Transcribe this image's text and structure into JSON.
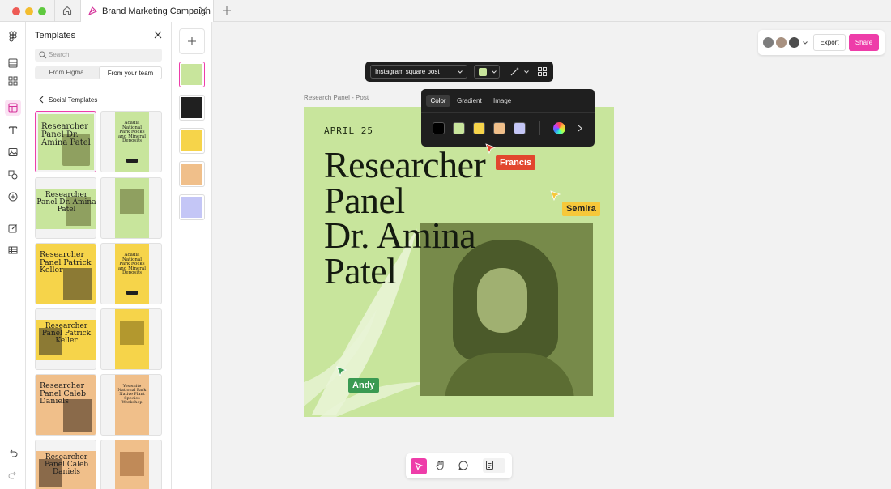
{
  "window": {
    "tab_title": "Brand Marketing Campaign"
  },
  "templates_panel": {
    "title": "Templates",
    "search_placeholder": "Search",
    "segments": [
      "From Figma",
      "From your team"
    ],
    "section_title": "Social Templates",
    "tiles": [
      {
        "text": "Researcher Panel Dr. Amina Patel",
        "bg": "#c8e59c",
        "selected": true
      },
      {
        "text": "Acadia National Park Rocks and Mineral Deposits",
        "bg": "#c8e59c"
      },
      {
        "text": "Researcher Panel Dr. Amina Patel",
        "bg": "#c8e59c"
      },
      {
        "text": "",
        "bg": "#c8e59c"
      },
      {
        "text": "Researcher Panel Patrick Keller",
        "bg": "#f6d44a"
      },
      {
        "text": "Acadia National Park Rocks and Mineral Deposits",
        "bg": "#f6d44a"
      },
      {
        "text": "Researcher Panel Patrick Keller",
        "bg": "#f6d44a"
      },
      {
        "text": "",
        "bg": "#f6d44a"
      },
      {
        "text": "Researcher Panel Caleb Daniels",
        "bg": "#f0bf8a"
      },
      {
        "text": "Yosemite National Park Native Plant Species Workshop",
        "bg": "#f0bf8a"
      },
      {
        "text": "Researcher Panel Caleb Daniels",
        "bg": "#f0bf8a"
      },
      {
        "text": "",
        "bg": "#f0bf8a"
      }
    ]
  },
  "canvas": {
    "artboard_label": "Research Panel - Post",
    "date": "APRIL 25",
    "headline": [
      "Researcher",
      "Panel",
      "Dr. Amina",
      "Patel"
    ]
  },
  "format_toolbar": {
    "format": "Instagram square post",
    "fill_color": "#c8e59c"
  },
  "color_popover": {
    "tabs": [
      "Color",
      "Gradient",
      "Image"
    ],
    "active_tab": "Color",
    "swatches": [
      "#000000",
      "#c8e59c",
      "#f6d44a",
      "#f0bf8a",
      "#c4c6f6"
    ]
  },
  "cursors": [
    {
      "name": "Francis",
      "color": "#e2462e"
    },
    {
      "name": "Semira",
      "color": "#f6c83a"
    },
    {
      "name": "Andy",
      "color": "#3a9a52"
    }
  ],
  "header_actions": {
    "export_label": "Export",
    "share_label": "Share"
  }
}
